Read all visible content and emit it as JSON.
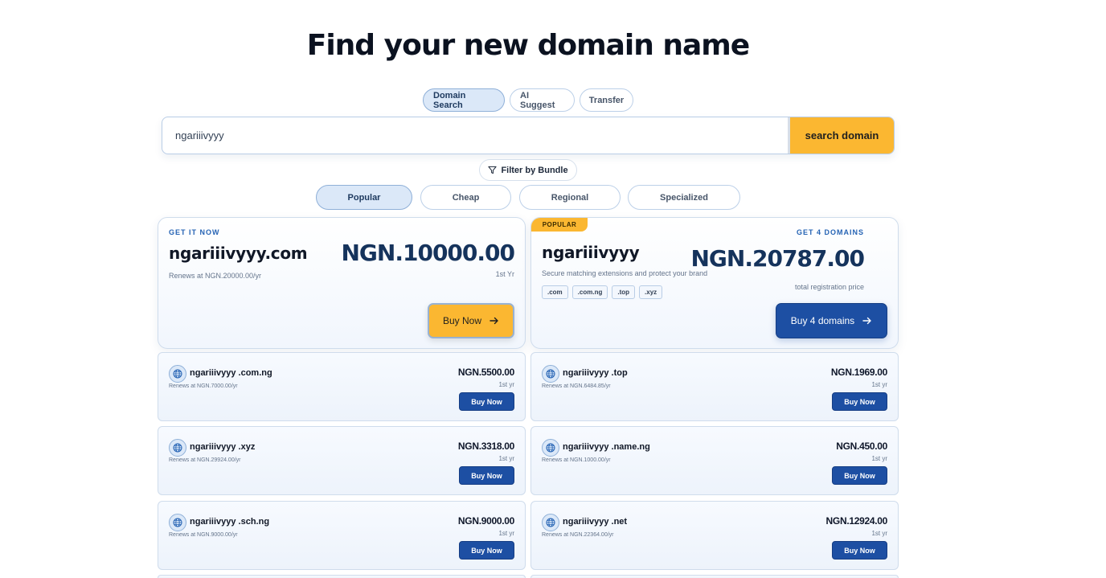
{
  "header": {
    "title": "Find your new domain name"
  },
  "mode_tabs": [
    {
      "label": "Domain Search",
      "active": true
    },
    {
      "label": "AI Suggest",
      "active": false
    },
    {
      "label": "Transfer",
      "active": false
    }
  ],
  "search": {
    "value": "ngariiivyyy",
    "button_label": "search domain"
  },
  "filter": {
    "label": "Filter by Bundle",
    "icon": "filter-icon"
  },
  "bundle_tabs": [
    {
      "label": "Popular",
      "active": true
    },
    {
      "label": "Cheap",
      "active": false
    },
    {
      "label": "Regional",
      "active": false
    },
    {
      "label": "Specialized",
      "active": false
    }
  ],
  "featured": {
    "eyebrow": "GET IT NOW",
    "domain": "ngariiivyyy.com",
    "price": "NGN.10000.00",
    "period": "1st Yr",
    "renew": "Renews at NGN.20000.00/yr",
    "buy_label": "Buy Now"
  },
  "bundle": {
    "badge": "POPULAR",
    "eyebrow": "GET 4 DOMAINS",
    "name": "ngariiivyyy",
    "description": "Secure matching extensions and protect your brand",
    "price": "NGN.20787.00",
    "price_note": "total registration price",
    "extensions": [
      ".com",
      ".com.ng",
      ".top",
      ".xyz"
    ],
    "buy_label": "Buy 4 domains"
  },
  "results": [
    {
      "domain": "ngariiivyyy .com.ng",
      "renew": "Renews at NGN.7000.00/yr",
      "price": "NGN.5500.00",
      "period": "1st yr",
      "buy_label": "Buy Now"
    },
    {
      "domain": "ngariiivyyy .top",
      "renew": "Renews at NGN.6484.85/yr",
      "price": "NGN.1969.00",
      "period": "1st yr",
      "buy_label": "Buy Now"
    },
    {
      "domain": "ngariiivyyy .xyz",
      "renew": "Renews at NGN.29924.00/yr",
      "price": "NGN.3318.00",
      "period": "1st yr",
      "buy_label": "Buy Now"
    },
    {
      "domain": "ngariiivyyy .name.ng",
      "renew": "Renews at NGN.1000.00/yr",
      "price": "NGN.450.00",
      "period": "1st yr",
      "buy_label": "Buy Now"
    },
    {
      "domain": "ngariiivyyy .sch.ng",
      "renew": "Renews at NGN.9000.00/yr",
      "price": "NGN.9000.00",
      "period": "1st yr",
      "buy_label": "Buy Now"
    },
    {
      "domain": "ngariiivyyy .net",
      "renew": "Renews at NGN.22364.00/yr",
      "price": "NGN.12924.00",
      "period": "1st yr",
      "buy_label": "Buy Now"
    }
  ],
  "colors": {
    "accent": "#fbb731",
    "primary": "#1d4fa3",
    "price_text": "#15335c"
  }
}
